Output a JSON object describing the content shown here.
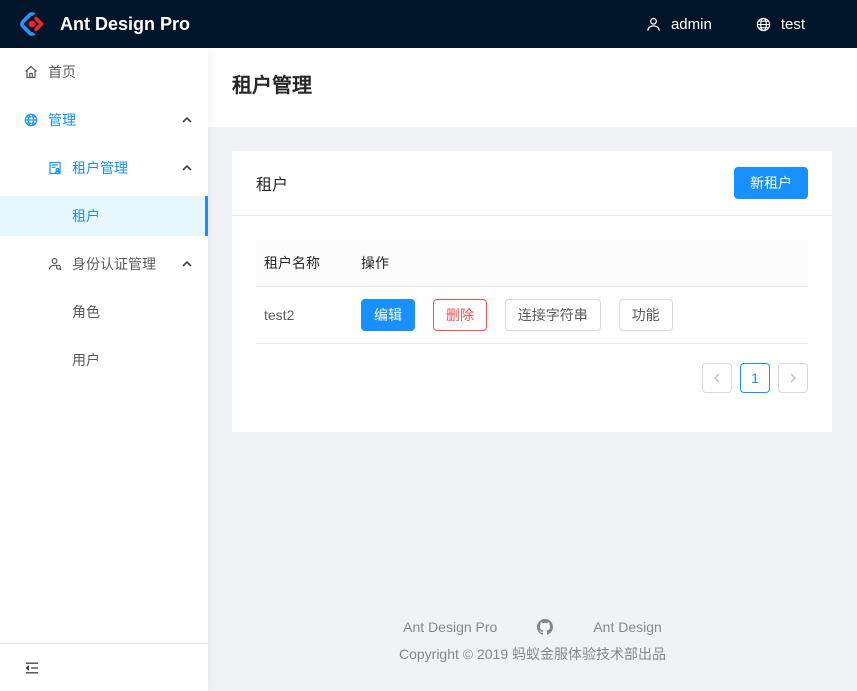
{
  "app": {
    "title": "Ant Design Pro"
  },
  "header": {
    "user_name": "admin",
    "tenant_name": "test"
  },
  "sidebar": {
    "items": {
      "home": "首页",
      "admin": "管理",
      "tenant_mgmt": "租户管理",
      "tenant": "租户",
      "identity_mgmt": "身份认证管理",
      "roles": "角色",
      "users": "用户"
    }
  },
  "page": {
    "title": "租户管理"
  },
  "card": {
    "title": "租户",
    "new_tenant_button": "新租户"
  },
  "table": {
    "columns": {
      "name": "租户名称",
      "actions": "操作"
    },
    "rows": [
      {
        "name": "test2",
        "actions": {
          "edit": "编辑",
          "delete": "删除",
          "connection_string": "连接字符串",
          "features": "功能"
        }
      }
    ]
  },
  "pagination": {
    "current_page": "1"
  },
  "footer": {
    "link_pro": "Ant Design Pro",
    "link_ant": "Ant Design",
    "copyright": "Copyright © 2019 蚂蚁金服体验技术部出品"
  },
  "icons": {
    "logo": "ant-design-logo",
    "user": "user-icon",
    "globe": "globe-icon",
    "home": "home-icon",
    "tenant_mgmt": "audit-icon",
    "identity": "user-search-icon",
    "submenu_caret": "chevron-up-icon",
    "collapse": "menu-fold-icon",
    "github": "github-icon",
    "prev": "chevron-left-icon",
    "next": "chevron-right-icon"
  },
  "colors": {
    "header_bg": "#001529",
    "primary": "#1890ff",
    "danger": "#ff4d4f",
    "selected_menu_bg": "#e6f7ff",
    "content_bg": "#f0f2f5",
    "table_header_bg": "#fafafa"
  }
}
